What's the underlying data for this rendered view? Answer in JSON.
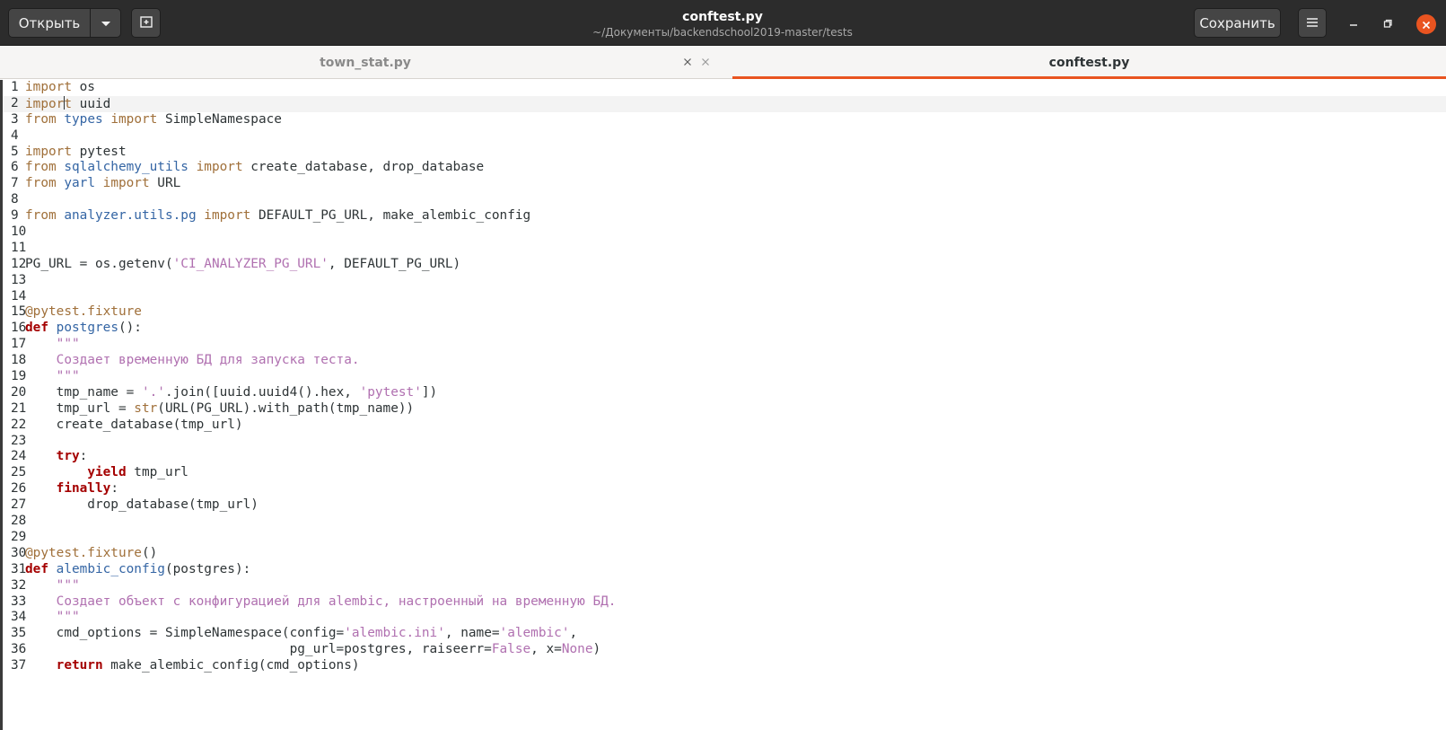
{
  "header": {
    "open_label": "Открыть",
    "save_label": "Сохранить",
    "title": "conftest.py",
    "subtitle": "~/Документы/backendschool2019-master/tests"
  },
  "tabs": [
    {
      "label": "town_stat.py",
      "active": false
    },
    {
      "label": "conftest.py",
      "active": true
    }
  ],
  "colors": {
    "accent": "#e95420",
    "keyword": "#a0703a",
    "bold_keyword": "#a40000",
    "module": "#3465a4",
    "string": "#b070b0"
  },
  "editor": {
    "current_line": 2,
    "lines": [
      "import os",
      "import uuid",
      "from types import SimpleNamespace",
      "",
      "import pytest",
      "from sqlalchemy_utils import create_database, drop_database",
      "from yarl import URL",
      "",
      "from analyzer.utils.pg import DEFAULT_PG_URL, make_alembic_config",
      "",
      "",
      "PG_URL = os.getenv('CI_ANALYZER_PG_URL', DEFAULT_PG_URL)",
      "",
      "",
      "@pytest.fixture",
      "def postgres():",
      "    \"\"\"",
      "    Создает временную БД для запуска теста.",
      "    \"\"\"",
      "    tmp_name = '.'.join([uuid.uuid4().hex, 'pytest'])",
      "    tmp_url = str(URL(PG_URL).with_path(tmp_name))",
      "    create_database(tmp_url)",
      "",
      "    try:",
      "        yield tmp_url",
      "    finally:",
      "        drop_database(tmp_url)",
      "",
      "",
      "@pytest.fixture()",
      "def alembic_config(postgres):",
      "    \"\"\"",
      "    Создает объект с конфигурацией для alembic, настроенный на временную БД.",
      "    \"\"\"",
      "    cmd_options = SimpleNamespace(config='alembic.ini', name='alembic',",
      "                                  pg_url=postgres, raiseerr=False, x=None)",
      "    return make_alembic_config(cmd_options)"
    ]
  }
}
